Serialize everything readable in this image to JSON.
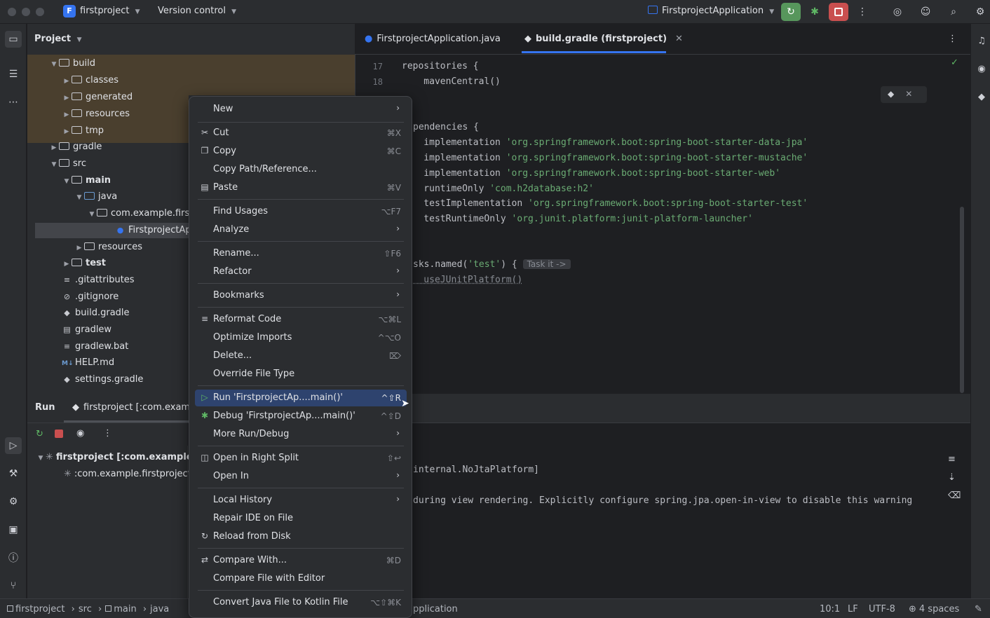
{
  "titlebar": {
    "project_badge": "F",
    "project_name": "firstproject",
    "version_control": "Version control",
    "run_config": "FirstprojectApplication"
  },
  "project_panel": {
    "header": "Project",
    "tree": [
      {
        "label": "build",
        "kind": "folder"
      },
      {
        "label": "classes",
        "kind": "folder"
      },
      {
        "label": "generated",
        "kind": "folder"
      },
      {
        "label": "resources",
        "kind": "folder"
      },
      {
        "label": "tmp",
        "kind": "folder"
      },
      {
        "label": "gradle",
        "kind": "folder"
      },
      {
        "label": "src",
        "kind": "folder"
      },
      {
        "label": "main",
        "kind": "folder"
      },
      {
        "label": "java",
        "kind": "folder"
      },
      {
        "label": "com.example.firs",
        "kind": "package"
      },
      {
        "label": "FirstprojectAp",
        "kind": "class"
      },
      {
        "label": "resources",
        "kind": "folder"
      },
      {
        "label": "test",
        "kind": "folder"
      },
      {
        "label": ".gitattributes",
        "kind": "file"
      },
      {
        "label": ".gitignore",
        "kind": "file"
      },
      {
        "label": "build.gradle",
        "kind": "file"
      },
      {
        "label": "gradlew",
        "kind": "file"
      },
      {
        "label": "gradlew.bat",
        "kind": "file"
      },
      {
        "label": "HELP.md",
        "kind": "file"
      },
      {
        "label": "settings.gradle",
        "kind": "file"
      }
    ]
  },
  "editor": {
    "tabs": [
      {
        "label": "FirstprojectApplication.java",
        "active": false
      },
      {
        "label": "build.gradle (firstproject)",
        "active": true
      }
    ],
    "line_numbers": [
      "17",
      "18"
    ],
    "lines": {
      "l1": "repositories {",
      "l2": "    mavenCentral()",
      "l3": "pendencies {",
      "l4_kw": "    implementation ",
      "l4_str": "'org.springframework.boot:spring-boot-starter-data-jpa'",
      "l5_kw": "    implementation ",
      "l5_str": "'org.springframework.boot:spring-boot-starter-mustache'",
      "l6_kw": "    implementation ",
      "l6_str": "'org.springframework.boot:spring-boot-starter-web'",
      "l7_kw": "    runtimeOnly ",
      "l7_str": "'com.h2database:h2'",
      "l8_kw": "    testImplementation ",
      "l8_str": "'org.springframework.boot:spring-boot-starter-test'",
      "l9_kw": "    testRuntimeOnly ",
      "l9_str": "'org.junit.platform:junit-platform-launcher'",
      "l10_a": "sks.named(",
      "l10_str": "'test'",
      "l10_b": ") { ",
      "l10_hint": "Task it ->",
      "l11": "    useJUnitPlatform()"
    }
  },
  "run_panel": {
    "tab_label": "Run",
    "config_tab": "firstproject [:com.examp",
    "tree_root": "firstproject [:com.example.fi",
    "tree_child": ":com.example.firstproject.",
    "console_line1": "internal.NoJtaPlatform]",
    "console_line2": "during view rendering. Explicitly configure spring.jpa.open-in-view to disable this warning"
  },
  "context_menu": {
    "items": [
      {
        "label": "New",
        "shortcut": "",
        "submenu": true,
        "icon": ""
      },
      {
        "label": "Cut",
        "shortcut": "⌘X",
        "submenu": false,
        "icon": "scissors-icon"
      },
      {
        "label": "Copy",
        "shortcut": "⌘C",
        "submenu": false,
        "icon": "copy-icon"
      },
      {
        "label": "Copy Path/Reference...",
        "shortcut": "",
        "submenu": false,
        "icon": ""
      },
      {
        "label": "Paste",
        "shortcut": "⌘V",
        "submenu": false,
        "icon": "paste-icon"
      },
      {
        "label": "Find Usages",
        "shortcut": "⌥F7",
        "submenu": false,
        "icon": ""
      },
      {
        "label": "Analyze",
        "shortcut": "",
        "submenu": true,
        "icon": ""
      },
      {
        "label": "Rename...",
        "shortcut": "⇧F6",
        "submenu": false,
        "icon": ""
      },
      {
        "label": "Refactor",
        "shortcut": "",
        "submenu": true,
        "icon": ""
      },
      {
        "label": "Bookmarks",
        "shortcut": "",
        "submenu": true,
        "icon": ""
      },
      {
        "label": "Reformat Code",
        "shortcut": "⌥⌘L",
        "submenu": false,
        "icon": "reformat-icon"
      },
      {
        "label": "Optimize Imports",
        "shortcut": "^⌥O",
        "submenu": false,
        "icon": ""
      },
      {
        "label": "Delete...",
        "shortcut": "⌦",
        "submenu": false,
        "icon": ""
      },
      {
        "label": "Override File Type",
        "shortcut": "",
        "submenu": false,
        "icon": ""
      },
      {
        "label": "Run 'FirstprojectAp....main()'",
        "shortcut": "^⇧R",
        "submenu": false,
        "icon": "run-icon"
      },
      {
        "label": "Debug 'FirstprojectAp....main()'",
        "shortcut": "^⇧D",
        "submenu": false,
        "icon": "debug-icon"
      },
      {
        "label": "More Run/Debug",
        "shortcut": "",
        "submenu": true,
        "icon": ""
      },
      {
        "label": "Open in Right Split",
        "shortcut": "⇧↩",
        "submenu": false,
        "icon": "split-icon"
      },
      {
        "label": "Open In",
        "shortcut": "",
        "submenu": true,
        "icon": ""
      },
      {
        "label": "Local History",
        "shortcut": "",
        "submenu": true,
        "icon": ""
      },
      {
        "label": "Repair IDE on File",
        "shortcut": "",
        "submenu": false,
        "icon": ""
      },
      {
        "label": "Reload from Disk",
        "shortcut": "",
        "submenu": false,
        "icon": "reload-icon"
      },
      {
        "label": "Compare With...",
        "shortcut": "⌘D",
        "submenu": false,
        "icon": "compare-icon"
      },
      {
        "label": "Compare File with Editor",
        "shortcut": "",
        "submenu": false,
        "icon": ""
      },
      {
        "label": "Convert Java File to Kotlin File",
        "shortcut": "⌥⇧⌘K",
        "submenu": false,
        "icon": ""
      }
    ]
  },
  "statusbar": {
    "breadcrumbs": [
      "firstproject",
      "src",
      "main",
      "java"
    ],
    "crumb_tail": "pplication",
    "position": "10:1",
    "line_sep": "LF",
    "encoding": "UTF-8",
    "indent": "4 spaces"
  }
}
